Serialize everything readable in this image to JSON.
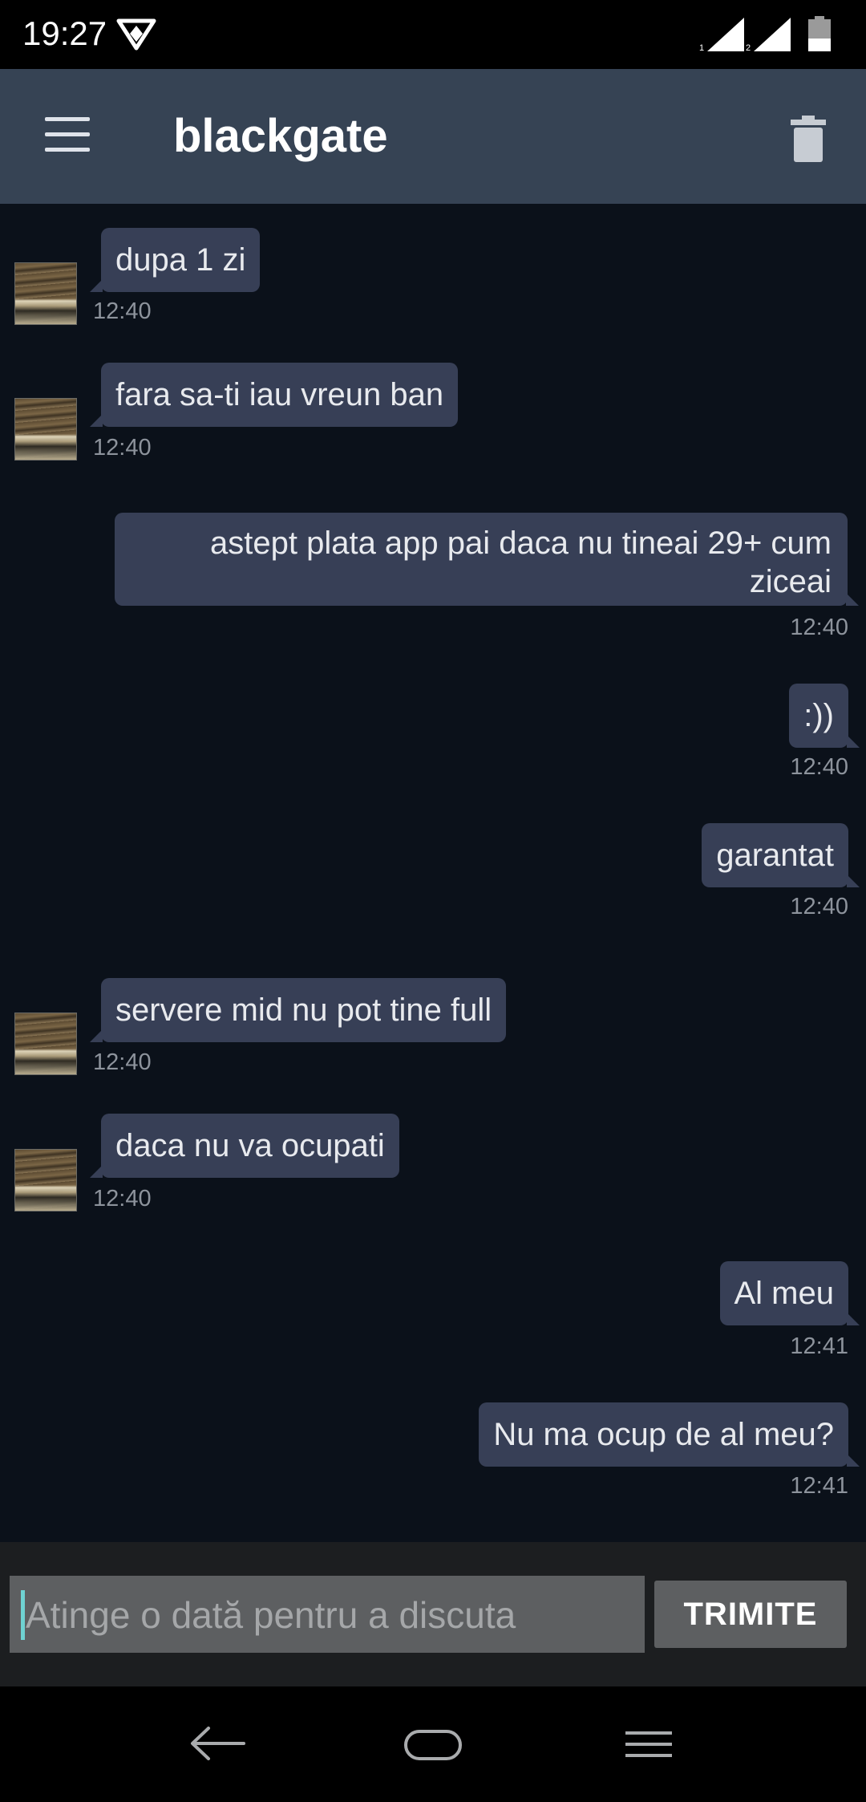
{
  "status_bar": {
    "time": "19:27",
    "icons": [
      "vpn-icon",
      "signal-sim1-icon",
      "signal-sim2-icon",
      "battery-icon"
    ],
    "sim1_label": "1",
    "sim2_label": "2"
  },
  "app_bar": {
    "title": "blackgate",
    "menu_icon": "hamburger-menu-icon",
    "delete_icon": "trash-icon"
  },
  "messages": [
    {
      "direction": "incoming",
      "text": "dupa 1 zi",
      "time": "12:40"
    },
    {
      "direction": "incoming",
      "text": "fara sa-ti iau vreun ban",
      "time": "12:40"
    },
    {
      "direction": "outgoing",
      "text": "astept plata app pai daca nu tineai 29+ cum ziceai",
      "time": "12:40"
    },
    {
      "direction": "outgoing",
      "text": ":))",
      "time": "12:40"
    },
    {
      "direction": "outgoing",
      "text": "garantat",
      "time": "12:40"
    },
    {
      "direction": "incoming",
      "text": "servere mid nu pot tine full",
      "time": "12:40"
    },
    {
      "direction": "incoming",
      "text": "daca nu va ocupati",
      "time": "12:40"
    },
    {
      "direction": "outgoing",
      "text": "Al meu",
      "time": "12:41"
    },
    {
      "direction": "outgoing",
      "text": "Nu ma ocup de al meu?",
      "time": "12:41"
    }
  ],
  "composer": {
    "placeholder": "Atinge o dată pentru a discuta",
    "send_label": "TRIMITE"
  },
  "nav_bar": {
    "icons": [
      "back-icon",
      "home-icon",
      "recents-icon"
    ]
  },
  "colors": {
    "app_bar": "#364354",
    "chat_background": "#0b111a",
    "bubble": "#373f56",
    "composer_background": "#1c1e20",
    "input_field": "#5d5f61",
    "cursor": "#6fd2d2"
  }
}
